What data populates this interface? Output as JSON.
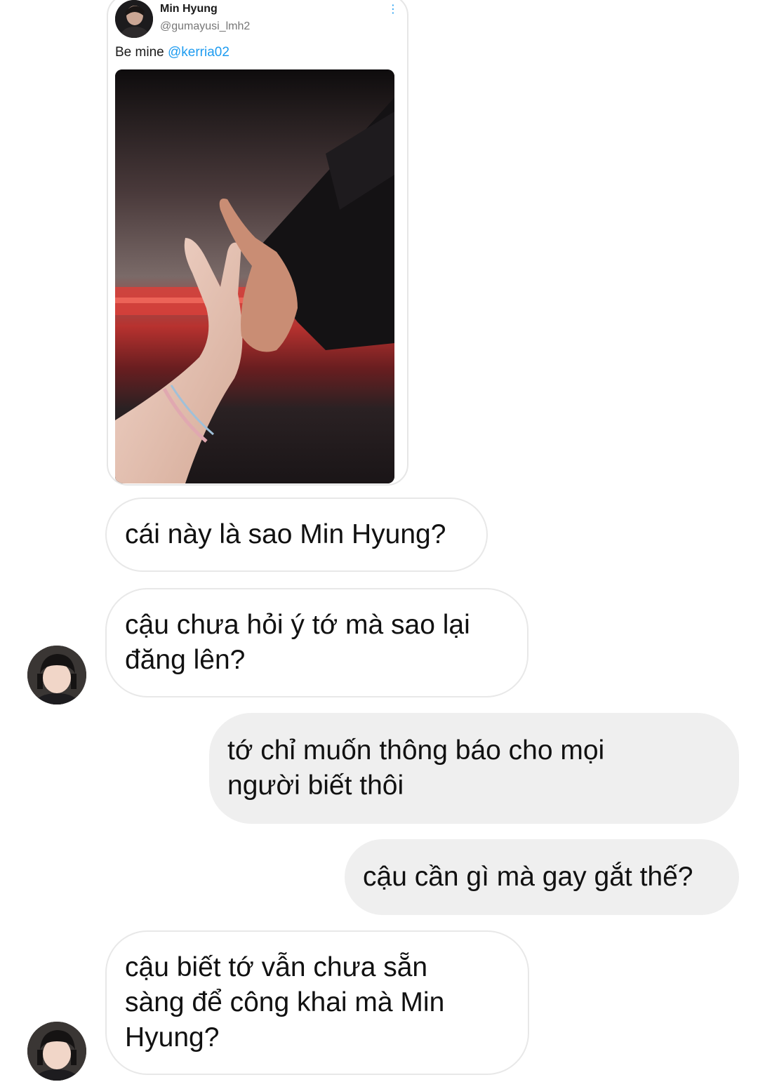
{
  "shared_tweet": {
    "author_name": "Min Hyung",
    "author_handle": "@gumayusi_lmh2",
    "text_prefix": "Be mine ",
    "mention": "@kerria02",
    "more_icon": "more-vertical-icon"
  },
  "messages": [
    {
      "direction": "received",
      "text": "cái này là sao Min Hyung?"
    },
    {
      "direction": "received",
      "text": "cậu chưa hỏi ý tớ mà sao lại\nđăng lên?"
    },
    {
      "direction": "sent",
      "text": "tớ chỉ muốn thông báo cho mọi\nngười biết thôi"
    },
    {
      "direction": "sent",
      "text": "cậu cần gì mà gay gắt thế?"
    },
    {
      "direction": "received",
      "text": "cậu biết tớ vẫn chưa sẵn\nsàng để công khai mà Min\nHyung?"
    }
  ],
  "colors": {
    "mention": "#1d9bf0",
    "sent_bubble": "#efefef",
    "received_border": "#e8e8e8"
  }
}
